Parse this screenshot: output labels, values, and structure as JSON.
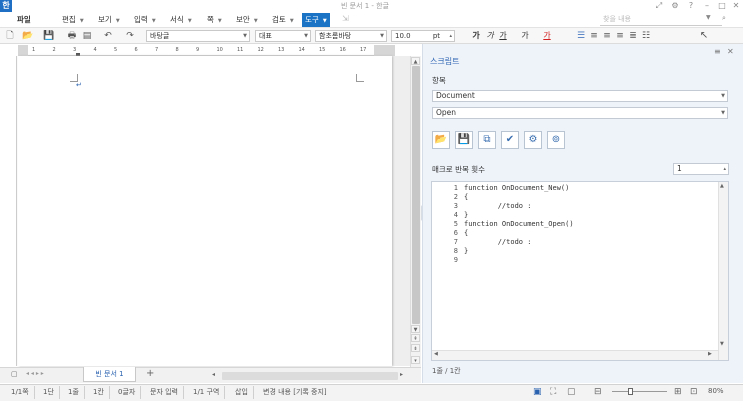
{
  "window": {
    "title": "빈 문서 1 - 한글",
    "app_logo": "한"
  },
  "menus": [
    {
      "label": "파일"
    },
    {
      "label": "편집"
    },
    {
      "label": "보기"
    },
    {
      "label": "입력"
    },
    {
      "label": "서식"
    },
    {
      "label": "쪽"
    },
    {
      "label": "보안"
    },
    {
      "label": "검토"
    },
    {
      "label": "도구"
    }
  ],
  "help": {
    "placeholder": "찾을 내용"
  },
  "toolbar": {
    "style": "바탕글",
    "para_style": "대표",
    "font": "함초롬바탕",
    "size": "10.0",
    "unit": "pt",
    "fmt": [
      "가",
      "가",
      "가",
      "가",
      "가"
    ],
    "accent": "#1a73c4"
  },
  "ruler": {
    "ticks": [
      "1",
      "2",
      "3",
      "4",
      "5",
      "6",
      "7",
      "8",
      "9",
      "10",
      "11",
      "12",
      "13",
      "14",
      "15",
      "16",
      "17"
    ]
  },
  "document": {
    "para_mark": "↵"
  },
  "tabs": {
    "doc_tab": "빈 문서 1",
    "add": "+"
  },
  "panel": {
    "title": "스크립트",
    "item_label": "항목",
    "object_value": "Document",
    "event_value": "Open",
    "repeat_label": "매크로 반복 횟수",
    "repeat_value": "1",
    "code_lines": [
      {
        "n": "1",
        "text": "function OnDocument_New()"
      },
      {
        "n": "2",
        "text": "{"
      },
      {
        "n": "3",
        "text": "        //todo :"
      },
      {
        "n": "4",
        "text": "}"
      },
      {
        "n": "5",
        "text": "function OnDocument_Open()"
      },
      {
        "n": "6",
        "text": "{"
      },
      {
        "n": "7",
        "text": "        //todo :"
      },
      {
        "n": "8",
        "text": "}"
      },
      {
        "n": "9",
        "text": ""
      }
    ],
    "position": "1줄 / 1칸"
  },
  "status": {
    "page": "1/1쪽",
    "col": "1단",
    "line": "1줄",
    "kan": "1칸",
    "chars": "0글자",
    "mode": "문자 입력",
    "section": "1/1 구역",
    "insert": "삽입",
    "track": "변경 내용 [기록 중지]",
    "zoom": "80%"
  }
}
